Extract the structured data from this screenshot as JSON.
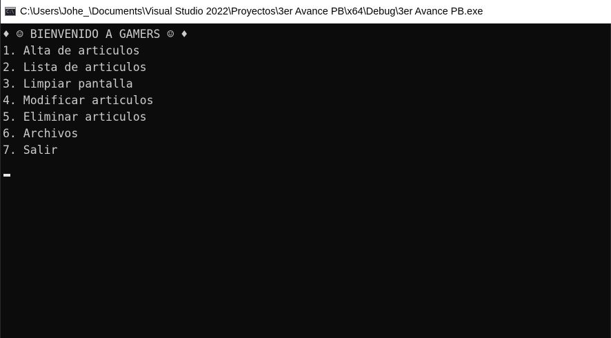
{
  "window": {
    "title": "C:\\Users\\Johe_\\Documents\\Visual Studio 2022\\Proyectos\\3er Avance PB\\x64\\Debug\\3er Avance PB.exe",
    "icon": "console-icon",
    "icon_glyph": "C:\\"
  },
  "console": {
    "header": "♦ ☺ BIENVENIDO A GAMERS ☺ ♦",
    "menu": [
      "1. Alta de articulos",
      "2. Lista de articulos",
      "3. Limpiar pantalla",
      "4. Modificar articulos",
      "5. Eliminar articulos",
      "6. Archivos",
      "7. Salir"
    ],
    "input": ""
  },
  "colors": {
    "console_background": "#0c0c0c",
    "console_text": "#cccccc",
    "titlebar_background": "#ffffff"
  }
}
